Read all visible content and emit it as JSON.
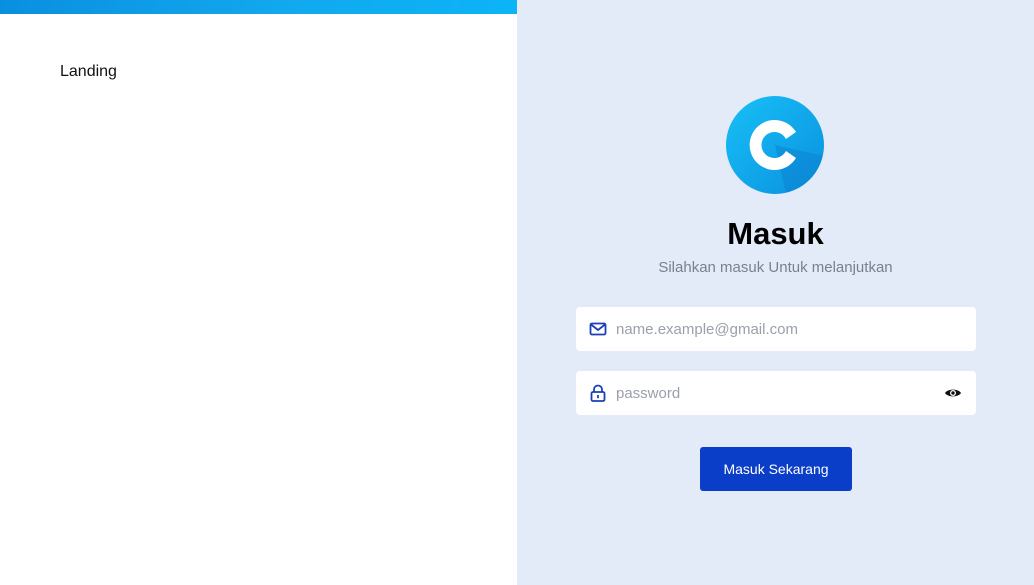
{
  "left_panel": {
    "nav_label": "Landing"
  },
  "login": {
    "title": "Masuk",
    "subtitle": "Silahkan masuk Untuk melanjutkan",
    "email_placeholder": "name.example@gmail.com",
    "email_value": "",
    "password_placeholder": "password",
    "password_value": "",
    "submit_label": "Masuk Sekarang"
  },
  "icons": {
    "logo": "logo-c-icon",
    "email": "mail-icon",
    "password": "lock-icon",
    "toggle": "eye-icon"
  },
  "colors": {
    "top_bar": "#0ea5e9",
    "right_bg": "#e3eaf8",
    "accent": "#0a3dc8",
    "logo_blue": "#0bb0f0"
  }
}
